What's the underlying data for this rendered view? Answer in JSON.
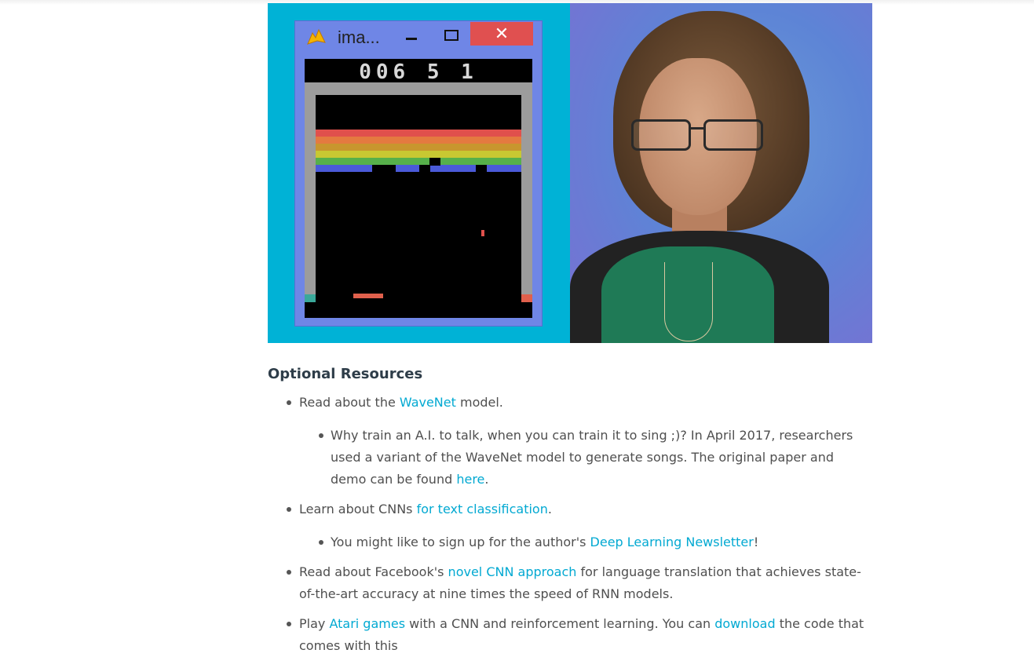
{
  "hero": {
    "game_window": {
      "title": "ima...",
      "close_glyph": "✕",
      "score": "006 5 1",
      "colors": {
        "background": "#00b2d6",
        "window": "#6f86e6",
        "close": "#e05050",
        "bricks": [
          "#e0504c",
          "#e47a40",
          "#c8962e",
          "#c8c832",
          "#56b04a",
          "#4a5ad8"
        ]
      },
      "icons": [
        "app-logo-icon",
        "minimize-icon",
        "maximize-icon",
        "close-icon"
      ]
    },
    "presenter": {
      "background": "#6a9ad8"
    }
  },
  "section": {
    "title": "Optional Resources",
    "items": [
      {
        "pre": "Read about the ",
        "link": "WaveNet",
        "post": " model.",
        "sub": [
          {
            "pre": "Why train an A.I. to talk, when you can train it to sing ;)? In April 2017, researchers used a variant of the WaveNet model to generate songs. The original paper and demo can be found ",
            "link": "here",
            "post": "."
          }
        ]
      },
      {
        "pre": "Learn about CNNs ",
        "link": "for text classification",
        "post": ".",
        "sub": [
          {
            "pre": "You might like to sign up for the author's ",
            "link": "Deep Learning Newsletter",
            "post": "!"
          }
        ]
      },
      {
        "pre": "Read about Facebook's ",
        "link": "novel CNN approach",
        "post": " for language translation that achieves state-of-the-art accuracy at nine times the speed of RNN models."
      },
      {
        "pre": "Play ",
        "link": "Atari games",
        "mid": " with a CNN and reinforcement learning. You can ",
        "link2": "download",
        "post": " the code that comes with this"
      }
    ],
    "link_color": "#02a9d2"
  }
}
